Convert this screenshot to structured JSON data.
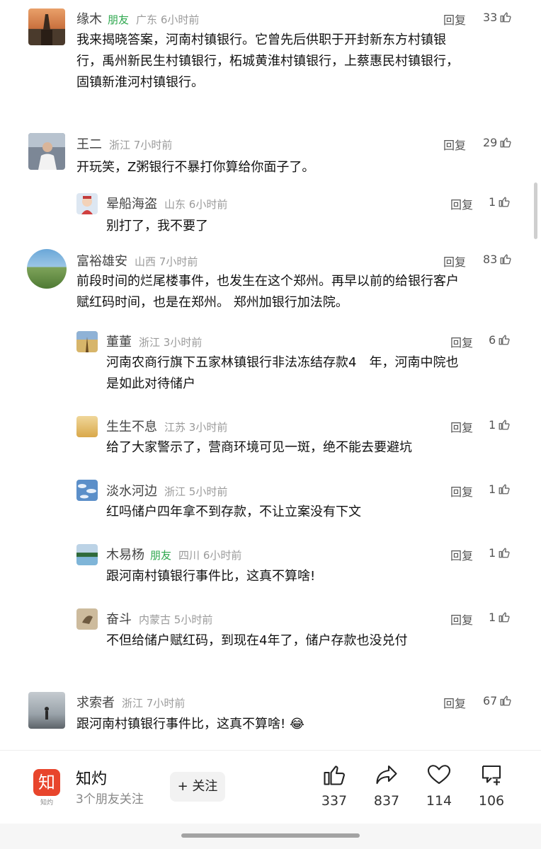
{
  "ui": {
    "reply_label": "回复",
    "friend_badge": "朋友"
  },
  "comments": [
    {
      "name": "缘木",
      "friend": true,
      "location": "广东",
      "time": "6小时前",
      "likes": "33",
      "lines": [
        "我来揭晓答案，河南村镇银行。它曾先后供职于开封新东方村镇银",
        "行，禹州新民生村镇银行，柘城黄淮村镇银行，上蔡惠民村镇银行，",
        "固镇新淮河村镇银行。"
      ]
    },
    {
      "name": "王二",
      "friend": false,
      "location": "浙江",
      "time": "7小时前",
      "likes": "29",
      "lines": [
        "开玩笑，Z粥银行不暴打你算给你面子了。"
      ]
    },
    {
      "name": "晕船海盗",
      "friend": false,
      "location": "山东",
      "time": "6小时前",
      "likes": "1",
      "lines": [
        "别打了，我不要了"
      ]
    },
    {
      "name": "富裕雄安",
      "friend": false,
      "location": "山西",
      "time": "7小时前",
      "likes": "83",
      "lines": [
        "前段时间的烂尾楼事件，也发生在这个郑州。再早以前的给银行客户",
        "赋红码时间，也是在郑州。 郑州加银行加法院。"
      ]
    },
    {
      "name": "董董",
      "friend": false,
      "location": "浙江",
      "time": "3小时前",
      "likes": "6",
      "lines": [
        "河南农商行旗下五家林镇银行非法冻结存款4　年，河南中院也",
        "是如此对待储户"
      ]
    },
    {
      "name": "生生不息",
      "friend": false,
      "location": "江苏",
      "time": "3小时前",
      "likes": "1",
      "lines": [
        "给了大家警示了，营商环境可见一斑，绝不能去要避坑"
      ]
    },
    {
      "name": "淡水河边",
      "friend": false,
      "location": "浙江",
      "time": "5小时前",
      "likes": "1",
      "lines": [
        "红吗储户四年拿不到存款，不让立案没有下文"
      ]
    },
    {
      "name": "木易杨",
      "friend": true,
      "location": "四川",
      "time": "6小时前",
      "likes": "1",
      "lines": [
        "跟河南村镇银行事件比，这真不算啥!"
      ]
    },
    {
      "name": "奋斗",
      "friend": false,
      "location": "内蒙古",
      "time": "5小时前",
      "likes": "1",
      "lines": [
        "不但给储户赋红码，到现在4年了，储户存款也没兑付"
      ]
    },
    {
      "name": "求索者",
      "friend": false,
      "location": "浙江",
      "time": "7小时前",
      "likes": "67",
      "lines": [
        "跟河南村镇银行事件比，这真不算啥!"
      ],
      "emoji": "😂"
    }
  ],
  "footer": {
    "logo_glyph": "知",
    "logo_caption": "知灼",
    "account_name": "知灼",
    "follow_info": "3个朋友关注",
    "follow_button": "+ 关注",
    "actions": [
      {
        "icon": "thumbs-up-icon",
        "count": "337"
      },
      {
        "icon": "share-icon",
        "count": "837"
      },
      {
        "icon": "heart-icon",
        "count": "114"
      },
      {
        "icon": "comment-add-icon",
        "count": "106"
      }
    ]
  },
  "colors": {
    "friend": "#2fa84f",
    "logo": "#e8452c"
  }
}
